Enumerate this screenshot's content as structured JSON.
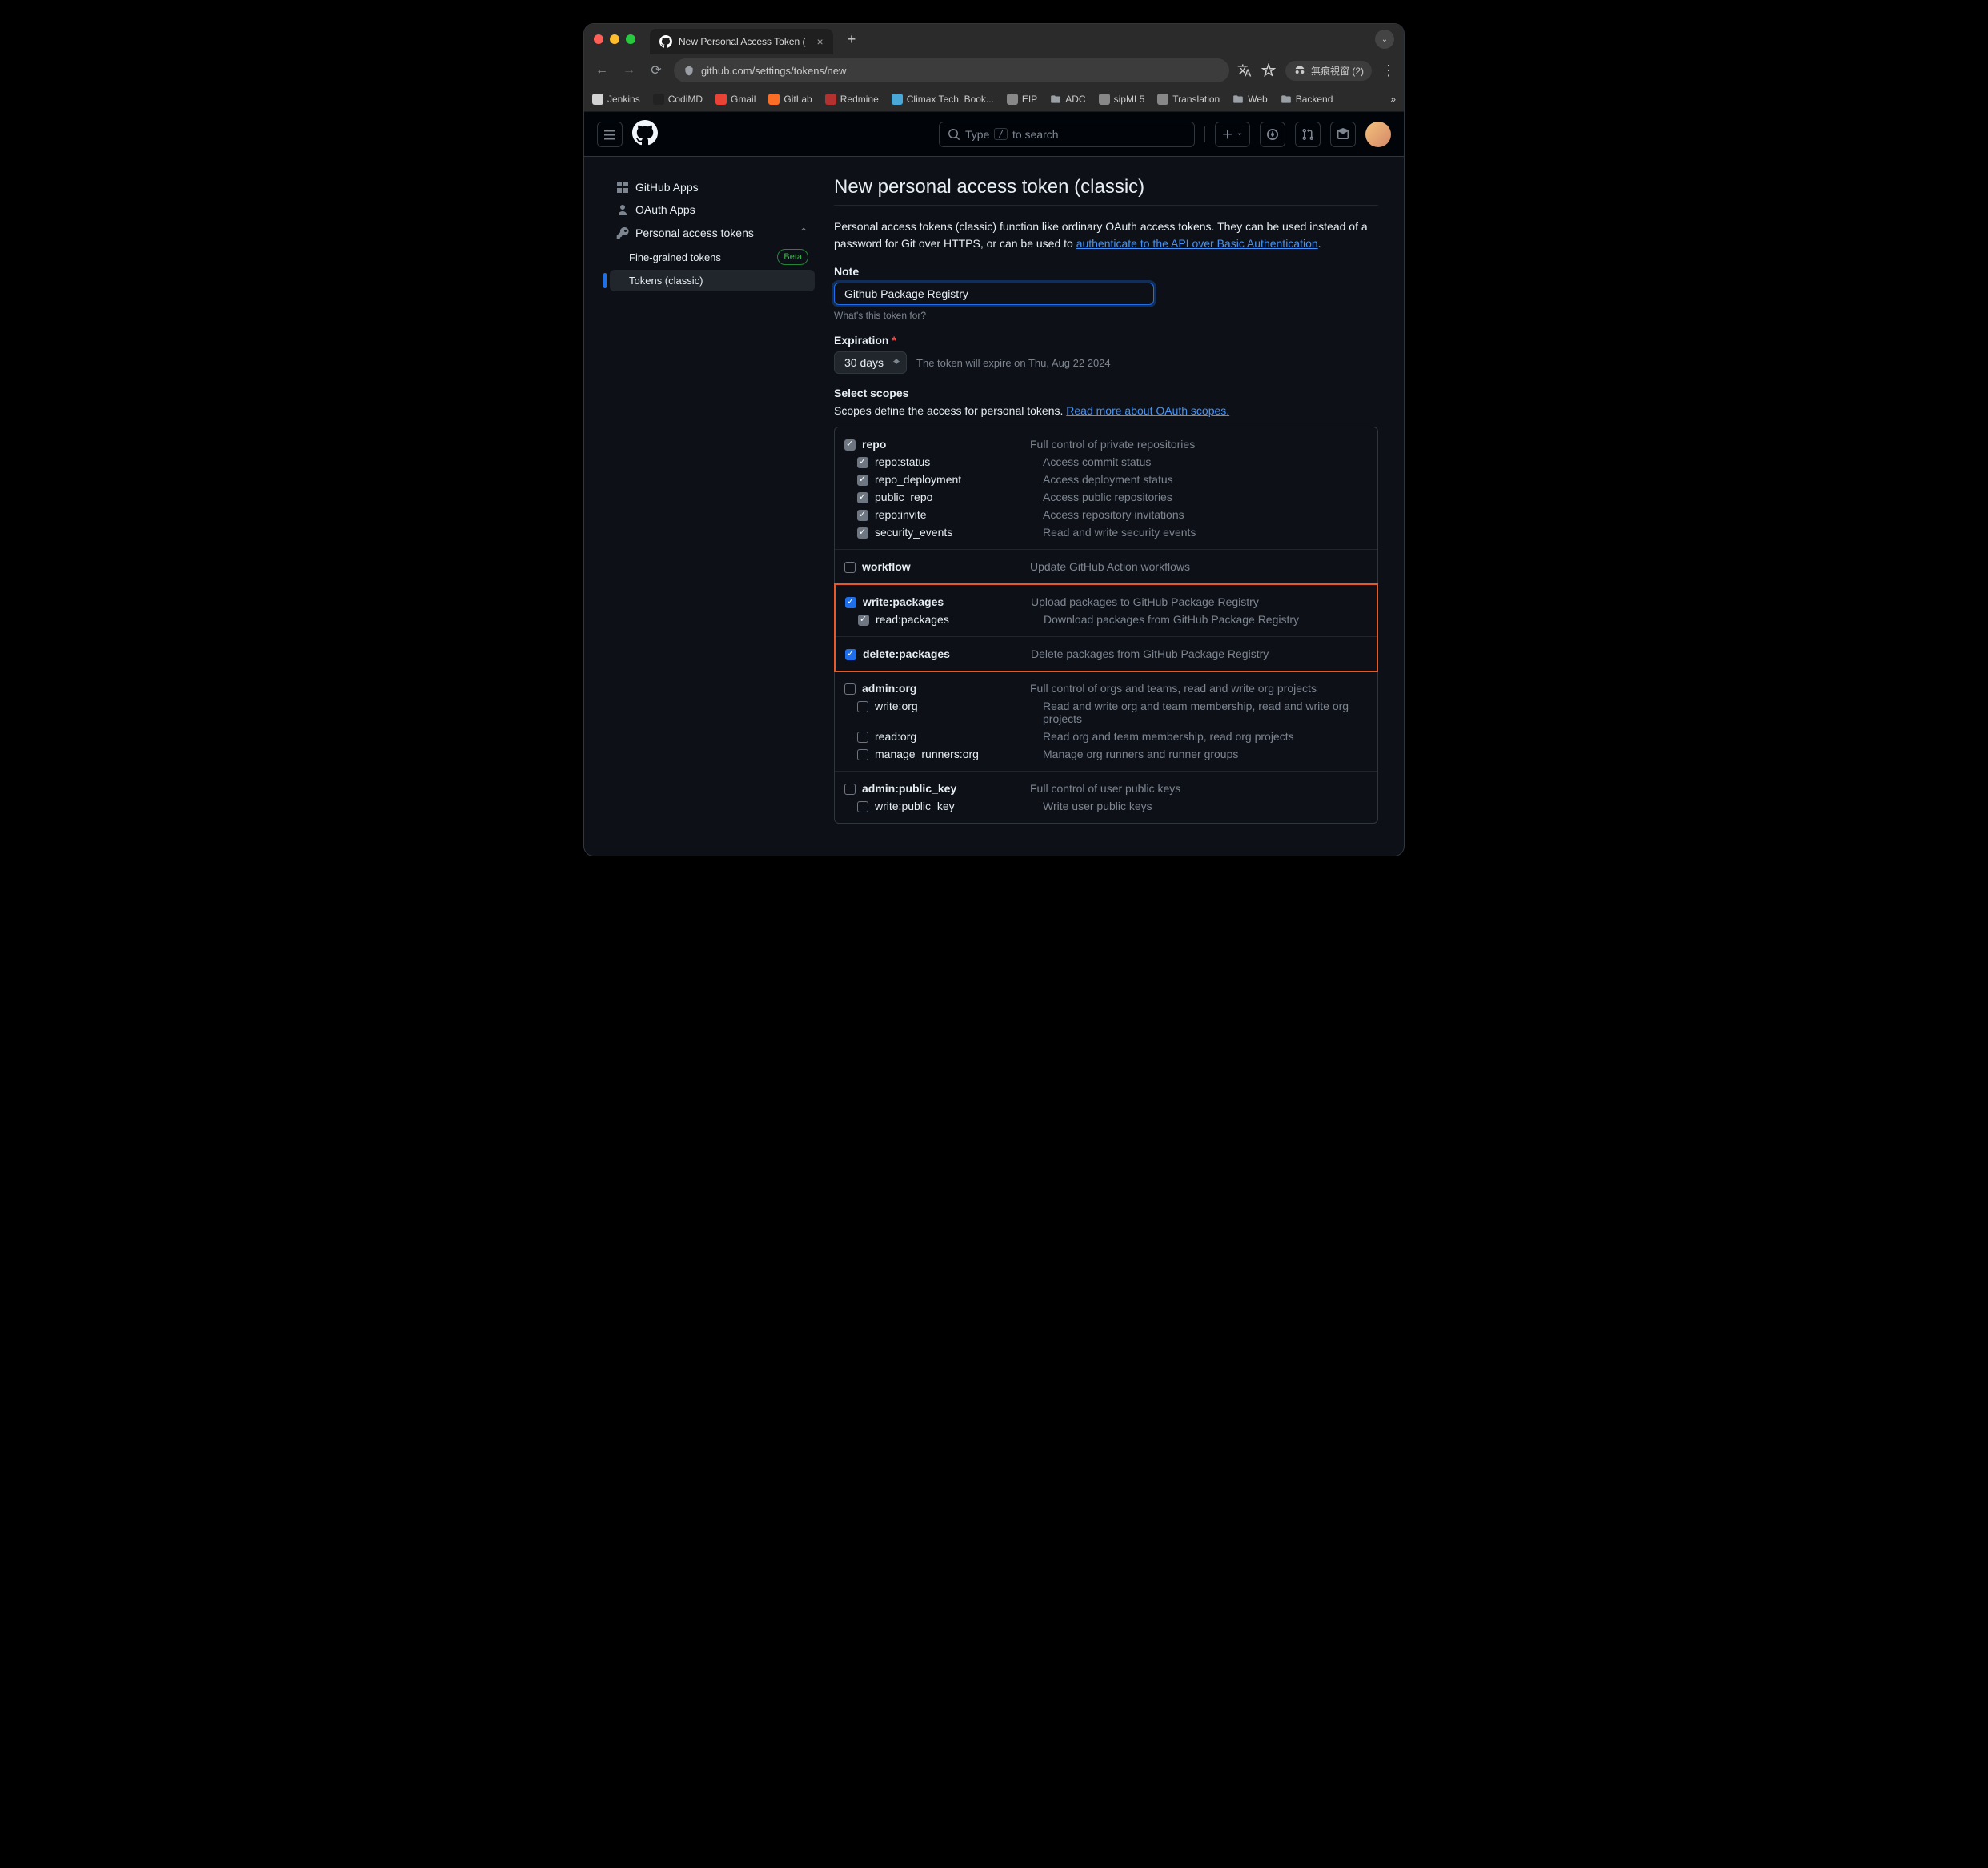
{
  "browser": {
    "tab_title": "New Personal Access Token (",
    "url_display": "github.com/settings/tokens/new",
    "incognito_label": "無痕視窗 (2)",
    "bookmarks": [
      {
        "label": "Jenkins",
        "color": "#d3d3d3"
      },
      {
        "label": "CodiMD",
        "color": "#222"
      },
      {
        "label": "Gmail",
        "color": "#ea4335"
      },
      {
        "label": "GitLab",
        "color": "#fc6d26"
      },
      {
        "label": "Redmine",
        "color": "#b3312e"
      },
      {
        "label": "Climax Tech. Book...",
        "color": "#4aa8d8"
      },
      {
        "label": "EIP",
        "color": "#888"
      },
      {
        "label": "ADC",
        "color": "",
        "folder": true
      },
      {
        "label": "sipML5",
        "color": "#888"
      },
      {
        "label": "Translation",
        "color": "#888"
      },
      {
        "label": "Web",
        "color": "",
        "folder": true
      },
      {
        "label": "Backend",
        "color": "",
        "folder": true
      }
    ]
  },
  "gh_header": {
    "search_prefix": "Type",
    "search_key": "/",
    "search_suffix": "to search"
  },
  "sidebar": {
    "items": [
      {
        "label": "GitHub Apps",
        "icon": "apps"
      },
      {
        "label": "OAuth Apps",
        "icon": "person"
      },
      {
        "label": "Personal access tokens",
        "icon": "key",
        "expanded": true
      }
    ],
    "sub_items": [
      {
        "label": "Fine-grained tokens",
        "badge": "Beta"
      },
      {
        "label": "Tokens (classic)",
        "active": true
      }
    ]
  },
  "main": {
    "title": "New personal access token (classic)",
    "intro_1": "Personal access tokens (classic) function like ordinary OAuth access tokens. They can be used instead of a password for Git over HTTPS, or can be used to ",
    "intro_link": "authenticate to the API over Basic Authentication",
    "note_label": "Note",
    "note_value": "Github Package Registry",
    "note_hint": "What's this token for?",
    "expiration_label": "Expiration",
    "expiration_value": "30 days",
    "expiration_hint": "The token will expire on Thu, Aug 22 2024",
    "scopes_label": "Select scopes",
    "scopes_intro": "Scopes define the access for personal tokens. ",
    "scopes_link": "Read more about OAuth scopes."
  },
  "scope_groups": [
    {
      "rows": [
        {
          "name": "repo",
          "desc": "Full control of private repositories",
          "state": "checked-grey"
        },
        {
          "name": "repo:status",
          "desc": "Access commit status",
          "state": "checked-grey",
          "child": true
        },
        {
          "name": "repo_deployment",
          "desc": "Access deployment status",
          "state": "checked-grey",
          "child": true
        },
        {
          "name": "public_repo",
          "desc": "Access public repositories",
          "state": "checked-grey",
          "child": true
        },
        {
          "name": "repo:invite",
          "desc": "Access repository invitations",
          "state": "checked-grey",
          "child": true
        },
        {
          "name": "security_events",
          "desc": "Read and write security events",
          "state": "checked-grey",
          "child": true
        }
      ]
    },
    {
      "rows": [
        {
          "name": "workflow",
          "desc": "Update GitHub Action workflows",
          "state": ""
        }
      ]
    },
    {
      "highlight": true,
      "rows": [
        {
          "name": "write:packages",
          "desc": "Upload packages to GitHub Package Registry",
          "state": "checked-blue"
        },
        {
          "name": "read:packages",
          "desc": "Download packages from GitHub Package Registry",
          "state": "checked-grey",
          "child": true
        }
      ]
    },
    {
      "highlight": true,
      "rows": [
        {
          "name": "delete:packages",
          "desc": "Delete packages from GitHub Package Registry",
          "state": "checked-blue"
        }
      ]
    },
    {
      "rows": [
        {
          "name": "admin:org",
          "desc": "Full control of orgs and teams, read and write org projects",
          "state": ""
        },
        {
          "name": "write:org",
          "desc": "Read and write org and team membership, read and write org projects",
          "state": "",
          "child": true
        },
        {
          "name": "read:org",
          "desc": "Read org and team membership, read org projects",
          "state": "",
          "child": true
        },
        {
          "name": "manage_runners:org",
          "desc": "Manage org runners and runner groups",
          "state": "",
          "child": true
        }
      ]
    },
    {
      "rows": [
        {
          "name": "admin:public_key",
          "desc": "Full control of user public keys",
          "state": ""
        },
        {
          "name": "write:public_key",
          "desc": "Write user public keys",
          "state": "",
          "child": true
        }
      ]
    }
  ]
}
